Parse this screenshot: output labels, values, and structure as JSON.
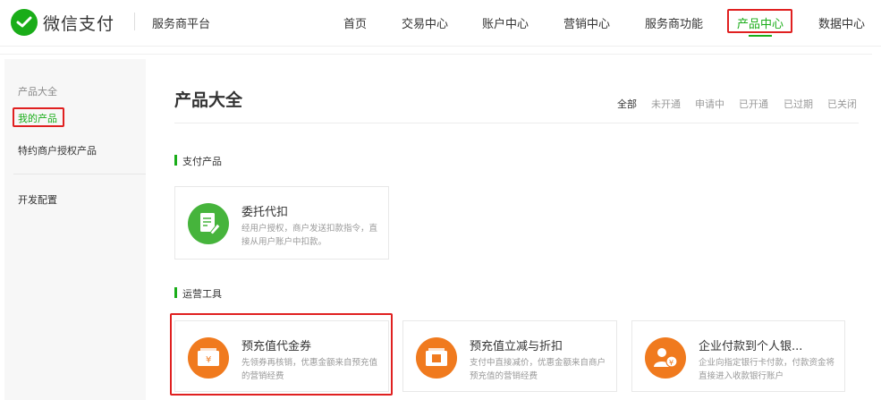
{
  "header": {
    "brand": "微信支付",
    "platform": "服务商平台",
    "nav": [
      {
        "label": "首页"
      },
      {
        "label": "交易中心"
      },
      {
        "label": "账户中心"
      },
      {
        "label": "营销中心"
      },
      {
        "label": "服务商功能"
      },
      {
        "label": "产品中心",
        "active": true
      },
      {
        "label": "数据中心"
      }
    ]
  },
  "sidebar": {
    "group": "产品大全",
    "items": [
      {
        "label": "我的产品",
        "active": true
      },
      {
        "label": "特约商户授权产品"
      },
      {
        "label": "开发配置"
      }
    ]
  },
  "content": {
    "title": "产品大全",
    "filters": [
      "全部",
      "未开通",
      "申请中",
      "已开通",
      "已过期",
      "已关闭"
    ],
    "sections": [
      {
        "label": "支付产品",
        "cards": [
          {
            "title": "委托代扣",
            "desc": "经用户授权，商户发送扣款指令，直接从用户账户中扣款。",
            "icon": "document-pen-icon",
            "color": "#46b43c"
          }
        ]
      },
      {
        "label": "运营工具",
        "cards": [
          {
            "title": "预充值代金券",
            "desc": "先领券再核销，优惠金额来自预充值的营销经费",
            "icon": "coupon-yen-icon",
            "color": "#f07a1e"
          },
          {
            "title": "预充值立减与折扣",
            "desc": "支付中直接减价，优惠金额来自商户预充值的营销经费",
            "icon": "discount-ticket-icon",
            "color": "#f07a1e"
          },
          {
            "title": "企业付款到个人银...",
            "desc": "企业向指定银行卡付款，付款资金将直接进入收款银行账户",
            "icon": "enterprise-payment-icon",
            "color": "#f07a1e"
          }
        ]
      }
    ]
  },
  "colors": {
    "accent": "#1aad19",
    "highlight": "#e02020",
    "orange": "#f07a1e"
  }
}
